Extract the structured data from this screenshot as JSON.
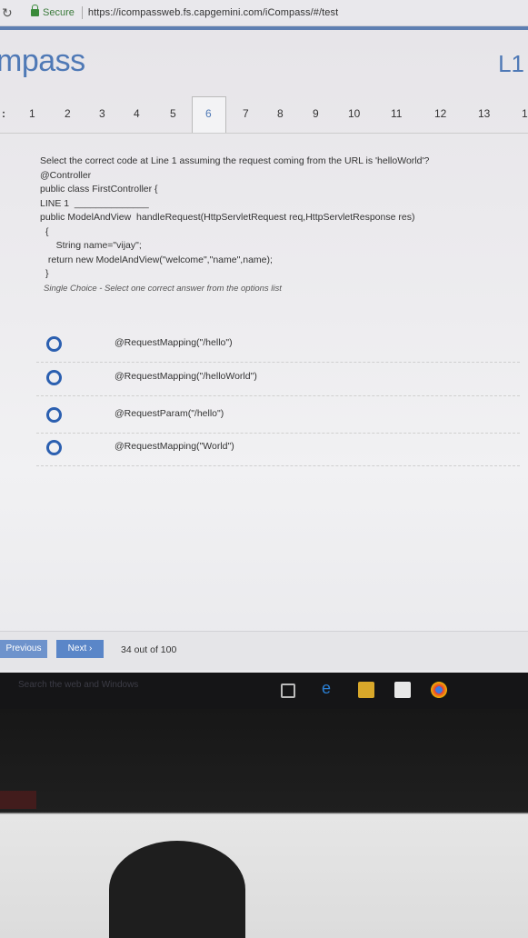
{
  "browser": {
    "secure_label": "Secure",
    "url": "https://icompassweb.fs.capgemini.com/iCompass/#/test"
  },
  "header": {
    "logo": "mpass",
    "level": "L1"
  },
  "qnav": {
    "prefix": ":",
    "numbers": [
      "1",
      "2",
      "3",
      "4",
      "5",
      "6",
      "7",
      "8",
      "9",
      "10",
      "11",
      "12",
      "13",
      "1"
    ],
    "active": "6"
  },
  "question": {
    "text": "Select the correct code at Line 1 assuming the request coming from the URL is 'helloWorld'?",
    "code": [
      "@Controller",
      "public class FirstController {",
      "LINE 1  ______________",
      "public ModelAndView  handleRequest(HttpServletRequest req,HttpServletResponse res)",
      "{",
      "    String name=\"vijay\";",
      " return new ModelAndView(\"welcome\",\"name\",name);",
      "}"
    ],
    "hint": "Single Choice - Select one correct answer from the options list"
  },
  "options": [
    "@RequestMapping(\"/hello\")",
    "@RequestMapping(\"/helloWorld\")",
    "@RequestParam(\"/hello\")",
    "@RequestMapping(\"World\")"
  ],
  "footer": {
    "previous_label": "Previous",
    "next_label": "Next ›",
    "progress": "34 out of 100"
  },
  "taskbar": {
    "search_placeholder": "Search the web and Windows"
  },
  "colors": {
    "brand": "#4f79b6",
    "radio": "#2b5fb0",
    "button": "#5a86c8"
  }
}
